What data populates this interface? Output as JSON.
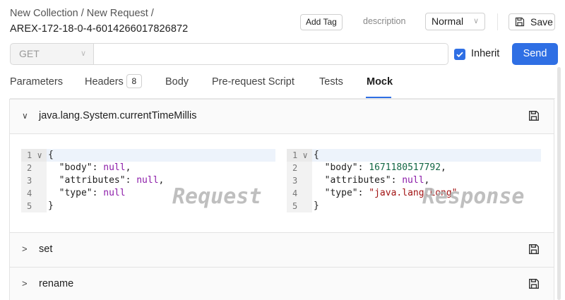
{
  "header": {
    "breadcrumb": [
      "New Collection",
      "New Request"
    ],
    "request_id": "AREX-172-18-0-4-6014266017826872",
    "add_tag_label": "Add Tag",
    "description_label": "description",
    "priority_value": "Normal",
    "save_label": "Save"
  },
  "request_bar": {
    "method": "GET",
    "url_value": "",
    "inherit_label": "Inherit",
    "inherit_checked": true,
    "send_label": "Send"
  },
  "tabs": [
    {
      "label": "Parameters"
    },
    {
      "label": "Headers",
      "badge": "8"
    },
    {
      "label": "Body"
    },
    {
      "label": "Pre-request Script"
    },
    {
      "label": "Tests"
    },
    {
      "label": "Mock",
      "active": true
    }
  ],
  "mocks": [
    {
      "title": "java.lang.System.currentTimeMillis",
      "expanded": true,
      "request_watermark": "Request",
      "response_watermark": "Response",
      "request_lines": [
        "1",
        "2",
        "3",
        "4",
        "5"
      ],
      "response_lines": [
        "1",
        "2",
        "3",
        "4",
        "5"
      ],
      "request_code": {
        "body_key": "\"body\"",
        "body_val": "null",
        "attributes_key": "\"attributes\"",
        "attributes_val": "null",
        "type_key": "\"type\"",
        "type_val": "null"
      },
      "response_code": {
        "body_key": "\"body\"",
        "body_val": "1671180517792",
        "attributes_key": "\"attributes\"",
        "attributes_val": "null",
        "type_key": "\"type\"",
        "type_val": "\"java.lang.Long\""
      }
    },
    {
      "title": "set",
      "expanded": false
    },
    {
      "title": "rename",
      "expanded": false
    }
  ],
  "colors": {
    "accent": "#2f6fe4",
    "keyword": "#8b1aa8",
    "number": "#116644",
    "string": "#a11212"
  },
  "icons": {
    "save": "floppy-disk-icon",
    "expand": "chevron-right-icon",
    "collapse": "chevron-down-icon",
    "check": "check-icon"
  }
}
